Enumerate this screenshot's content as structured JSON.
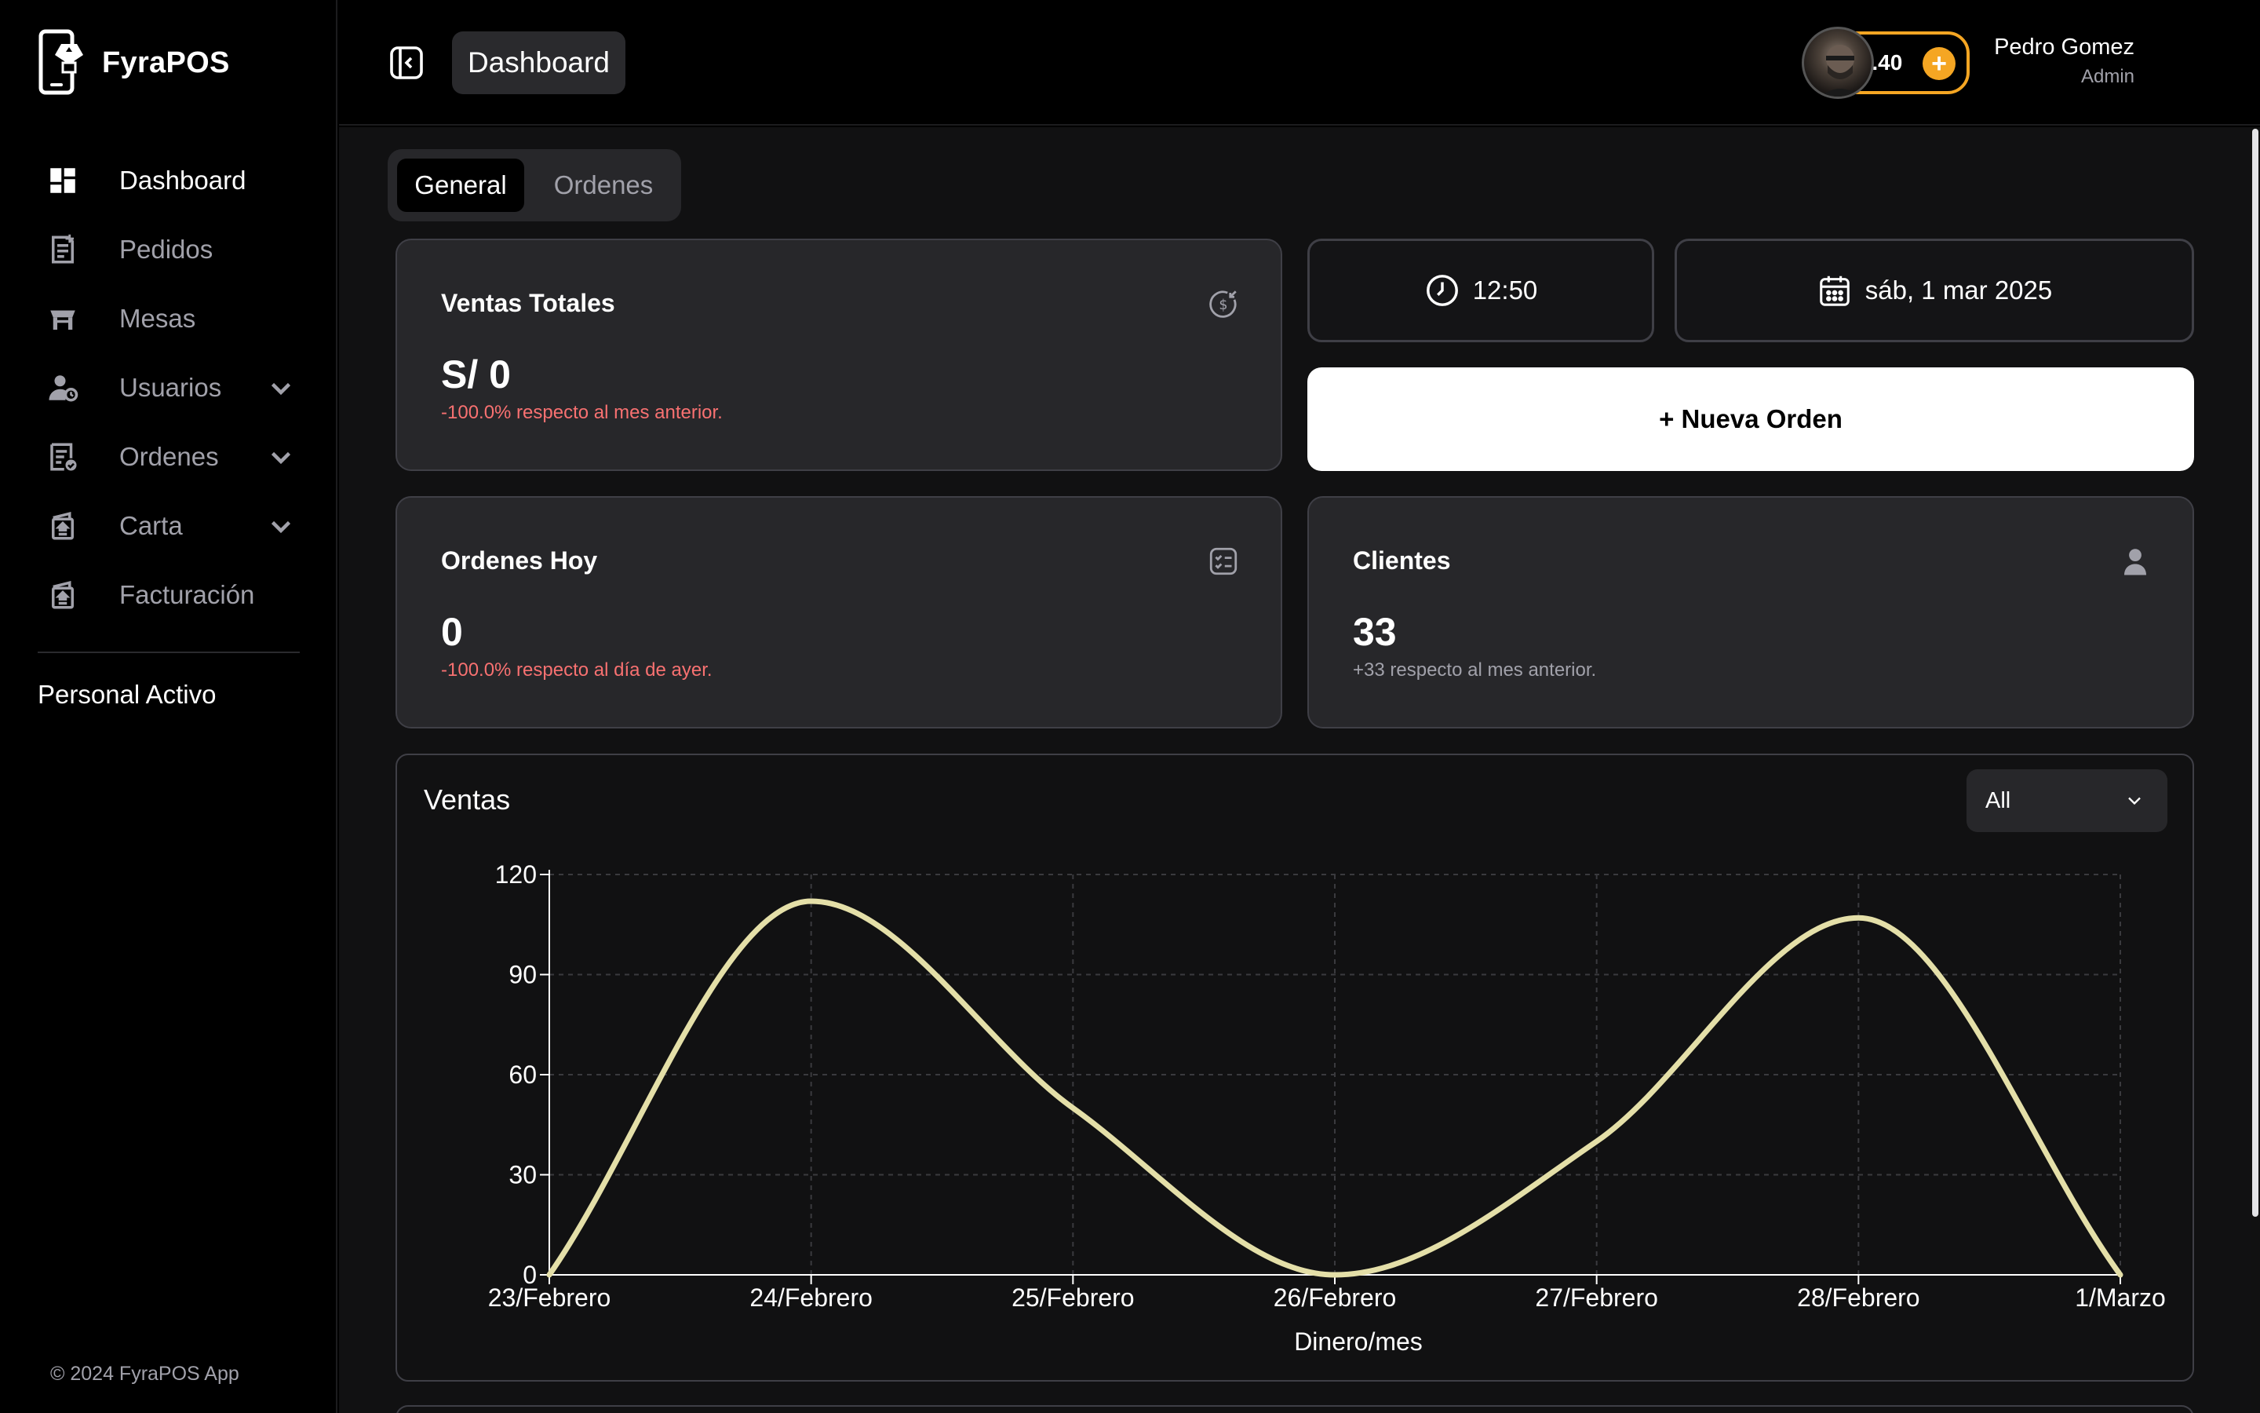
{
  "app": {
    "name": "FyraPOS"
  },
  "sidebar": {
    "items": [
      {
        "label": "Dashboard",
        "icon": "dashboard-icon",
        "active": true
      },
      {
        "label": "Pedidos",
        "icon": "orders-list-icon"
      },
      {
        "label": "Mesas",
        "icon": "table-icon"
      },
      {
        "label": "Usuarios",
        "icon": "users-icon",
        "expandable": true
      },
      {
        "label": "Ordenes",
        "icon": "order-check-icon",
        "expandable": true
      },
      {
        "label": "Carta",
        "icon": "menu-book-icon",
        "expandable": true
      },
      {
        "label": "Facturación",
        "icon": "invoice-icon"
      }
    ],
    "section_label": "Personal Activo",
    "footer": "© 2024 FyraPOS App"
  },
  "header": {
    "page_title": "Dashboard",
    "balance": "S/ 12.40",
    "balance_add": "+",
    "user_name": "Pedro Gomez",
    "user_role": "Admin"
  },
  "tabs": [
    {
      "label": "General",
      "active": true
    },
    {
      "label": "Ordenes",
      "active": false
    }
  ],
  "cards": {
    "ventas": {
      "title": "Ventas Totales",
      "value": "S/ 0",
      "sub": "-100.0% respecto al mes anterior."
    },
    "ordenes": {
      "title": "Ordenes Hoy",
      "value": "0",
      "sub": "-100.0% respecto al día de ayer."
    },
    "clientes": {
      "title": "Clientes",
      "value": "33",
      "sub": "+33 respecto al mes anterior."
    }
  },
  "time": "12:50",
  "date": "sáb, 1 mar 2025",
  "new_order_label": "+ Nueva Orden",
  "chart": {
    "title": "Ventas",
    "filter_value": "All"
  },
  "colors": {
    "accent": "#f5a623",
    "line": "#e4dfa8",
    "negative": "#f87171"
  },
  "chart_data": {
    "type": "line",
    "title": "Ventas",
    "xlabel": "Dinero/mes",
    "ylabel": "",
    "categories": [
      "23/Febrero",
      "24/Febrero",
      "25/Febrero",
      "26/Febrero",
      "27/Febrero",
      "28/Febrero",
      "1/Marzo"
    ],
    "series": [
      {
        "values": [
          0,
          112,
          50,
          0,
          40,
          107,
          0
        ]
      }
    ],
    "yticks": [
      0,
      30,
      60,
      90,
      120
    ],
    "ylim": [
      0,
      120
    ],
    "grid": true
  }
}
